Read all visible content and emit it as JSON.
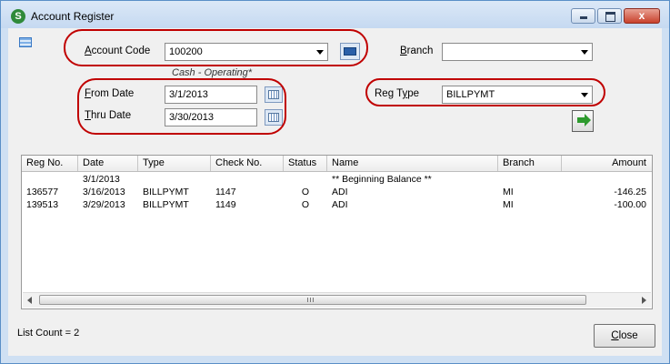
{
  "window": {
    "title": "Account Register",
    "close_glyph": "x"
  },
  "form": {
    "account_code_label_u": "A",
    "account_code_label_rest": "ccount Code",
    "account_code_value": "100200",
    "account_description": "Cash - Operating*",
    "branch_label_u": "B",
    "branch_label_rest": "ranch",
    "branch_value": "",
    "from_date_label_u": "F",
    "from_date_label_rest": "rom Date",
    "from_date_value": "3/1/2013",
    "thru_date_label_u": "T",
    "thru_date_label_rest": "hru Date",
    "thru_date_value": "3/30/2013",
    "reg_type_label_pre": "Reg T",
    "reg_type_label_u": "y",
    "reg_type_label_post": "pe",
    "reg_type_value": "BILLPYMT"
  },
  "grid": {
    "columns": [
      "Reg No.",
      "Date",
      "Type",
      "Check No.",
      "Status",
      "Name",
      "Branch",
      "Amount"
    ],
    "rows": [
      {
        "reg_no": "",
        "date": "3/1/2013",
        "type": "",
        "check_no": "",
        "status": "",
        "name": "** Beginning Balance **",
        "branch": "",
        "amount": ""
      },
      {
        "reg_no": "136577",
        "date": "3/16/2013",
        "type": "BILLPYMT",
        "check_no": "1147",
        "status": "O",
        "name": "ADI",
        "branch": "MI",
        "amount": "-146.25"
      },
      {
        "reg_no": "139513",
        "date": "3/29/2013",
        "type": "BILLPYMT",
        "check_no": "1149",
        "status": "O",
        "name": "ADI",
        "branch": "MI",
        "amount": "-100.00"
      }
    ]
  },
  "footer": {
    "list_count": "List Count = 2",
    "close_u": "C",
    "close_rest": "lose"
  },
  "icons": {
    "app": "s-logo-icon",
    "calendar": "calendar-icon",
    "lookup": "book-lookup-icon",
    "go": "green-arrow-icon",
    "menu": "list-menu-icon"
  },
  "colors": {
    "highlight_oval": "#c00000",
    "titlebar": "#c5d9f1",
    "close_button": "#c9412c",
    "go_arrow": "#2e9a2e"
  }
}
